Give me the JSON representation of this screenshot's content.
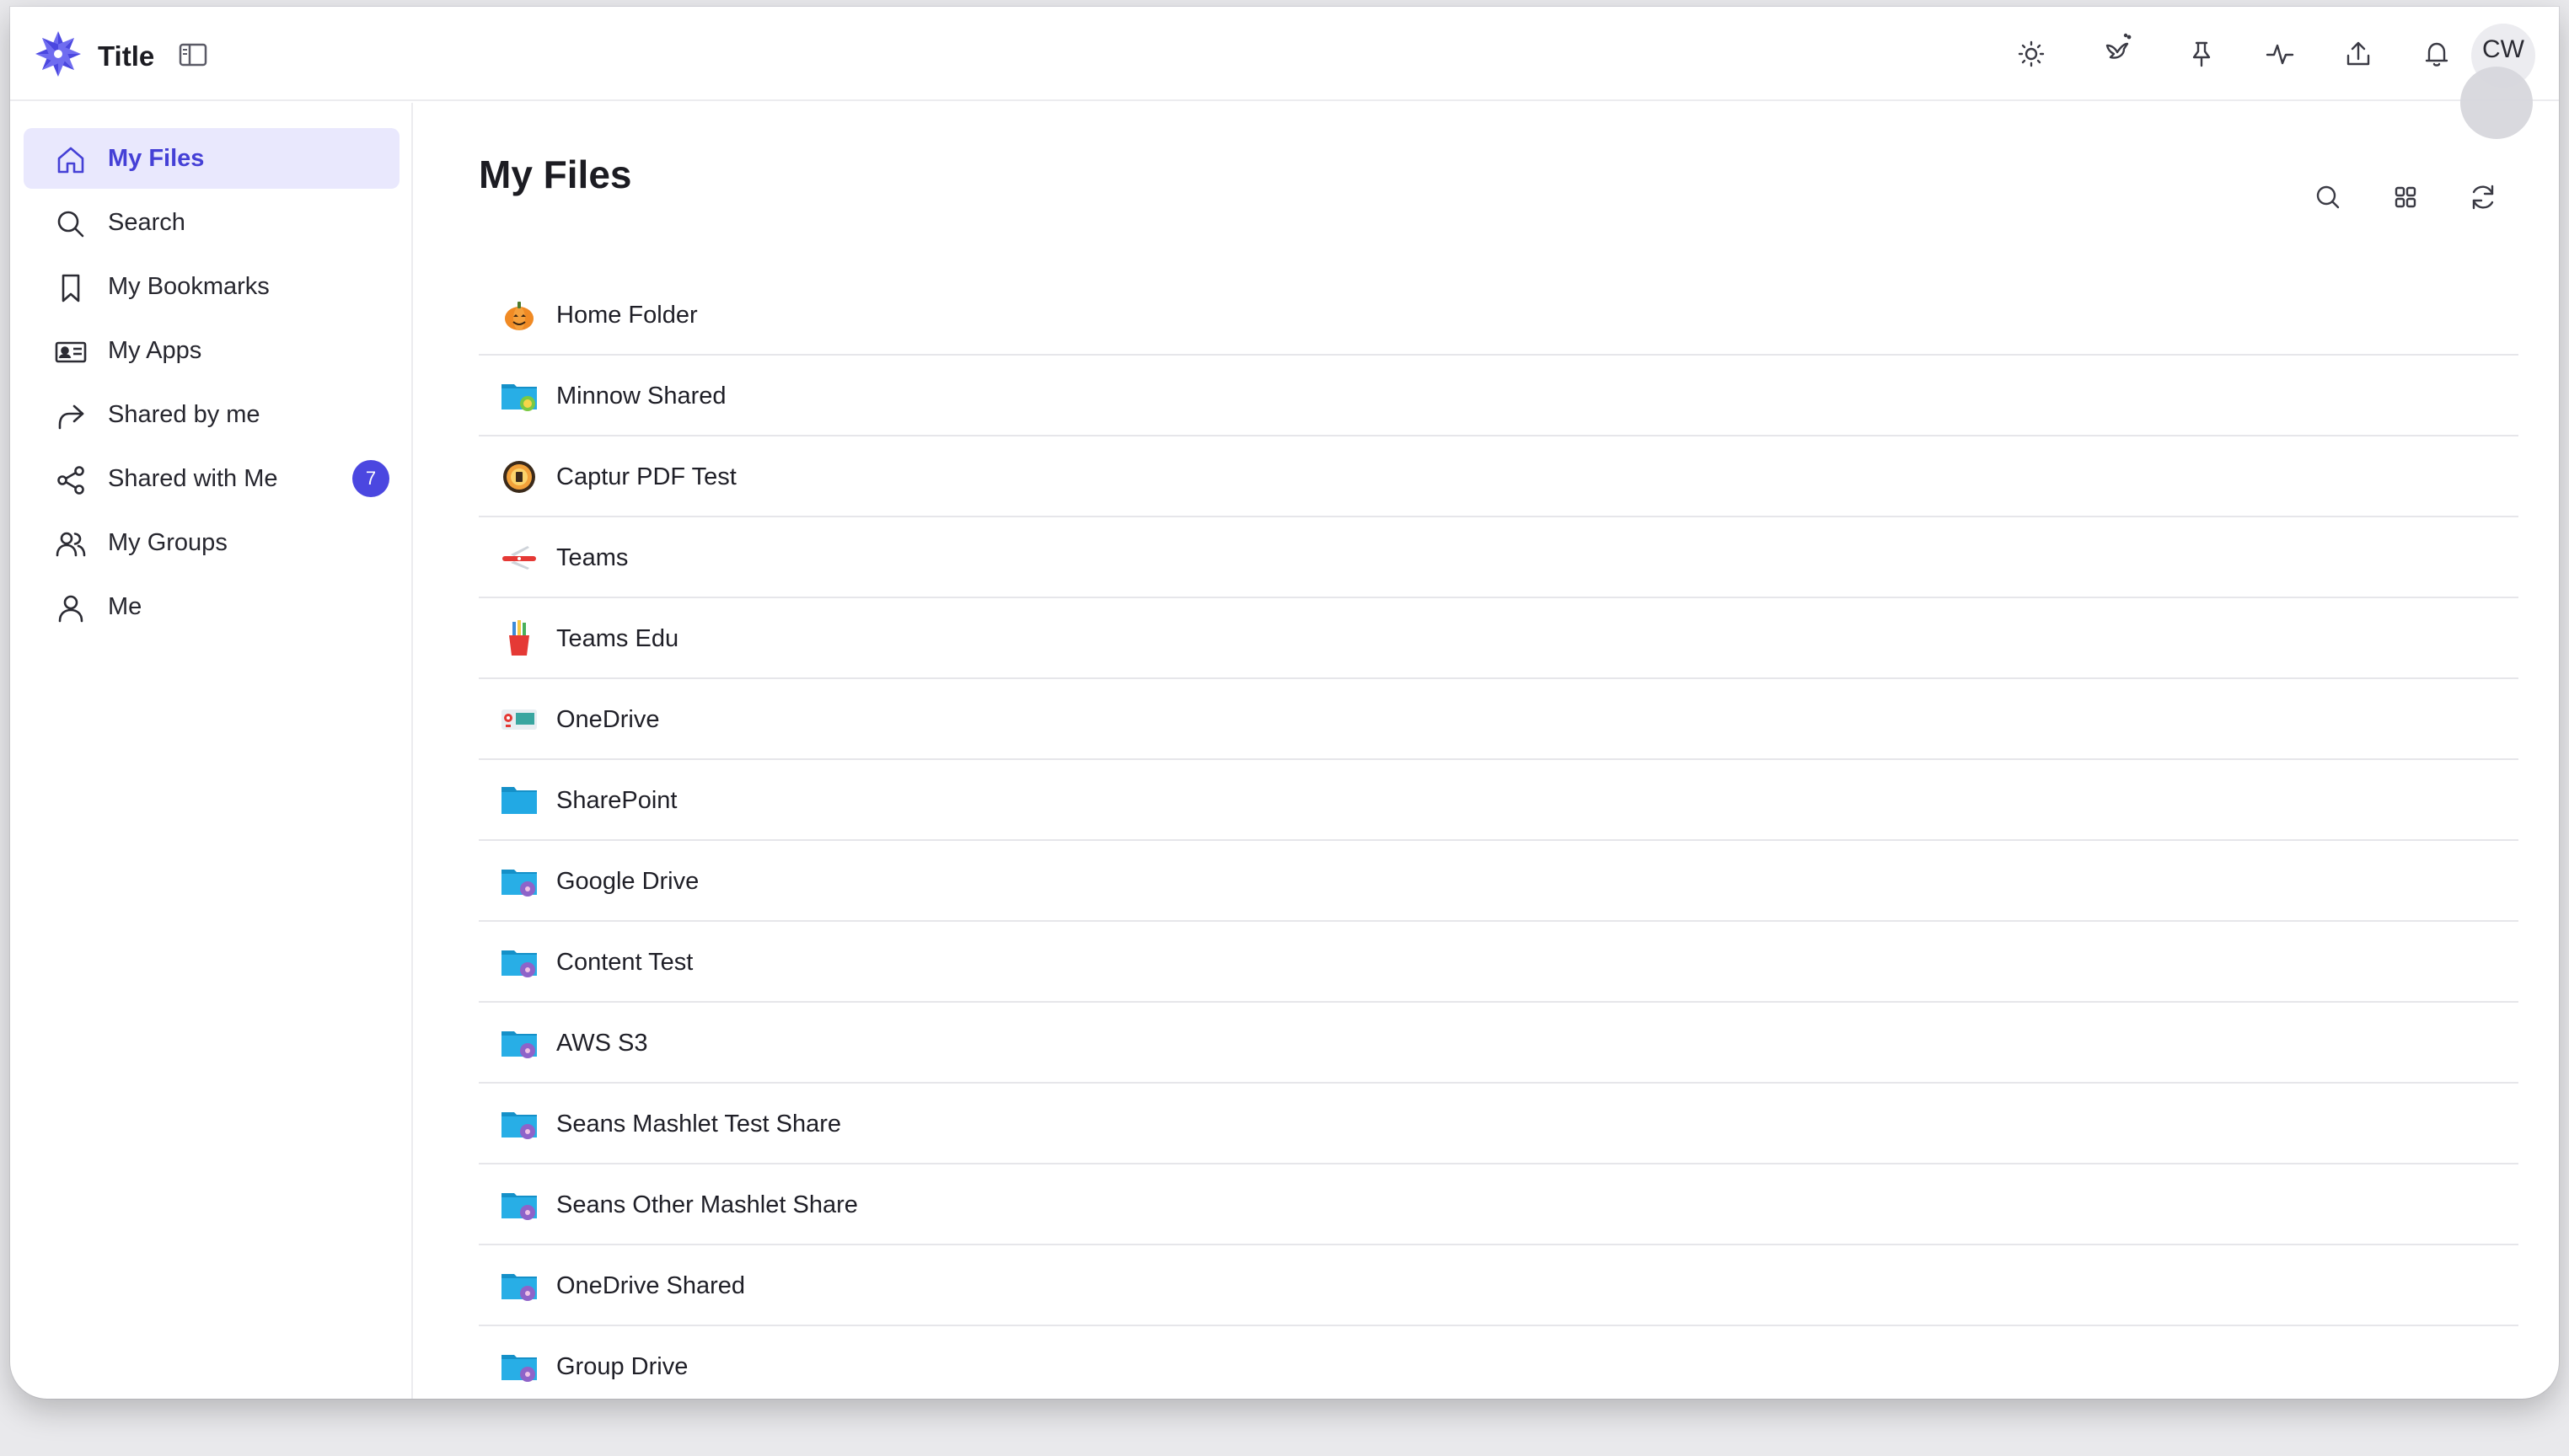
{
  "header": {
    "title": "Title",
    "avatar_initials": "CW",
    "icons": [
      "sun-icon",
      "bird-icon",
      "pin-icon",
      "activity-icon",
      "upload-icon",
      "bell-icon"
    ]
  },
  "sidebar": {
    "items": [
      {
        "label": "My Files",
        "icon": "home-icon",
        "active": true
      },
      {
        "label": "Search",
        "icon": "search-icon"
      },
      {
        "label": "My Bookmarks",
        "icon": "bookmark-icon"
      },
      {
        "label": "My Apps",
        "icon": "id-card-icon"
      },
      {
        "label": "Shared by me",
        "icon": "share-forward-icon"
      },
      {
        "label": "Shared with Me",
        "icon": "share-nodes-icon",
        "badge": "7"
      },
      {
        "label": "My Groups",
        "icon": "users-icon"
      },
      {
        "label": "Me",
        "icon": "user-icon"
      }
    ]
  },
  "main": {
    "title": "My Files",
    "toolbar_icons": [
      "search-icon",
      "grid-icon",
      "refresh-icon"
    ],
    "files": [
      {
        "name": "Home Folder",
        "icon": "pumpkin-icon"
      },
      {
        "name": "Minnow Shared",
        "icon": "shared-folder-icon"
      },
      {
        "name": "Captur PDF Test",
        "icon": "sun-badge-icon"
      },
      {
        "name": "Teams",
        "icon": "knife-icon"
      },
      {
        "name": "Teams Edu",
        "icon": "pencil-cup-icon"
      },
      {
        "name": "OneDrive",
        "icon": "projector-icon"
      },
      {
        "name": "SharePoint",
        "icon": "folder-icon"
      },
      {
        "name": "Google Drive",
        "icon": "shared-folder-icon"
      },
      {
        "name": "Content Test",
        "icon": "shared-folder-icon"
      },
      {
        "name": "AWS S3",
        "icon": "shared-folder-icon"
      },
      {
        "name": "Seans Mashlet Test Share",
        "icon": "shared-folder-icon"
      },
      {
        "name": "Seans Other Mashlet Share",
        "icon": "shared-folder-icon"
      },
      {
        "name": "OneDrive Shared",
        "icon": "shared-folder-icon"
      },
      {
        "name": "Group Drive",
        "icon": "shared-folder-icon"
      }
    ]
  },
  "colors": {
    "accent": "#4b47e0",
    "active_bg": "#e9e8fd",
    "folder_blue": "#1ea3dc"
  }
}
